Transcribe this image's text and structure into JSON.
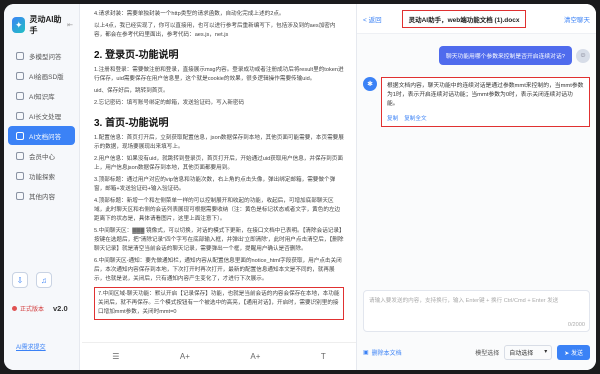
{
  "app": {
    "logo_text": "灵动AI助手",
    "version_label": "正式版本",
    "version": "v2.0",
    "feedback": "AI需求提交"
  },
  "sidebar": {
    "items": [
      {
        "label": "多模型问答"
      },
      {
        "label": "AI绘画SD版"
      },
      {
        "label": "AI知识库"
      },
      {
        "label": "AI长文处理"
      },
      {
        "label": "AI文档问答",
        "active": true
      },
      {
        "label": "会员中心"
      },
      {
        "label": "功能探索"
      },
      {
        "label": "其他内容"
      }
    ]
  },
  "document": {
    "intro": [
      "4.请求封装：需要单独封装一个http类型的请求函数，自动化完成上述的2点。",
      "以上4点，我已经实现了，你可以直接用，也可以进行参考后重新编写下，包括涉及到的aes加密内容，都会在参考代码里面出，参考代码：aes.js，net.js"
    ],
    "section2_title": "2. 登录页-功能说明",
    "section2": [
      "1.注册和登录：需要做注册和登录，直接展示msg内容。登录成功或者注册成功后将result里的token进行保存，uid需要保存在用户信息里，这个就是cookie的效果，很多逻辑操作需要传输uid。",
      "uid、保存好后，跳转到首页。",
      "2.忘记密码：填写账号绑定的邮箱，发送验证码，写入新密码"
    ],
    "section3_title": "3. 首页-功能说明",
    "section3": [
      "1.配置信息：首页打开后，立刻获取配置信息，json数据保存到本地，其他页面可能需要，本页需要展示的数据，现场要展现出来填写上。",
      "2.用户信息：如果没有uid，就跳转到登录页，首页打开后，开始通过uid获取用户信息，并保存到页面上，用户信息json数据保存到本地，其他页面都要用到。",
      "3.顶部标题：通过用户对应的vip信息和功能次数，右上角的点击头像，弹出绑定邮箱，需要做个弹窗，邮箱+发送验证码+输入验证码。",
      "4.顶部标题：新增一个和左侧菜单一样的可以控制展开和收起的功能，收起后，可增加底部聊天区域，此时聊天区和右侧的会话列表展现可根据需要收纳（注：黄色是标记状态或者文字，黄色的左边距离下的状态是，具体请看图片，这里上面注意下）。",
      "5.中间聊天区：▓▓▓ 镜像式，可以切换，对话的模式下更新，在接口文档中已表明。【清除会话记录】按键在选题后，把\"清除记录\"四个字写在底部输入框，并弹出'立即清除'，此时用户点击清空后，【删除聊天记录】就是清空当前会话的聊天记录，需要弹出一个框，提醒用户确认是否删除。",
      "6.中间聊天区-通知：要先做通知栏，通知内容从配置信息里面的notice_html字段获取，用户点击关闭后，本次通知内容保存到本地，下次打开时再次打开，最新的配置信息通知本文是不同的，就再展示，也就是说，关闭后，只有通知内容产生变化了，才进行下次展示。"
    ],
    "highlight": "7.中间区域-聊天功能：默认开启【记录保存】功能，也就是当前会话的内容会保存在本地，本功能关闭后，就不再保存。三个模式按钮有一个被选中的高亮，【通用对话】，开启时，需要识别里的接口增加mmt参数，关闭时mmt=0",
    "toolbar": [
      "☰",
      "A+",
      "A+",
      "T"
    ]
  },
  "chat": {
    "back": "< 返回",
    "title": "灵动AI助手，web端功能文档 (1).docx",
    "clear": "清空聊天",
    "user_message": "聊天功能用哪个参数来控制是否开启连续对话?",
    "user_avatar": "☺",
    "bot_avatar": "✱",
    "bot_message": "根据文档内容，聊天功能中的连续对话是通过参数mmt来控制的，当mmt参数为1时，表示开启连续对话功能；当mmt参数为0时，表示关闭连续对话功能。",
    "bot_actions": [
      "复制",
      "复制全文"
    ],
    "input_placeholder": "请输入要发送的内容，支持换行，输入 Enter键 + 换行  Ctrl/Cmd + Enter 发送",
    "counter": "0/2000",
    "delete_label": "删除本文档",
    "model_label": "模型选择",
    "model_value": "自动选择",
    "send_label": "发送"
  }
}
